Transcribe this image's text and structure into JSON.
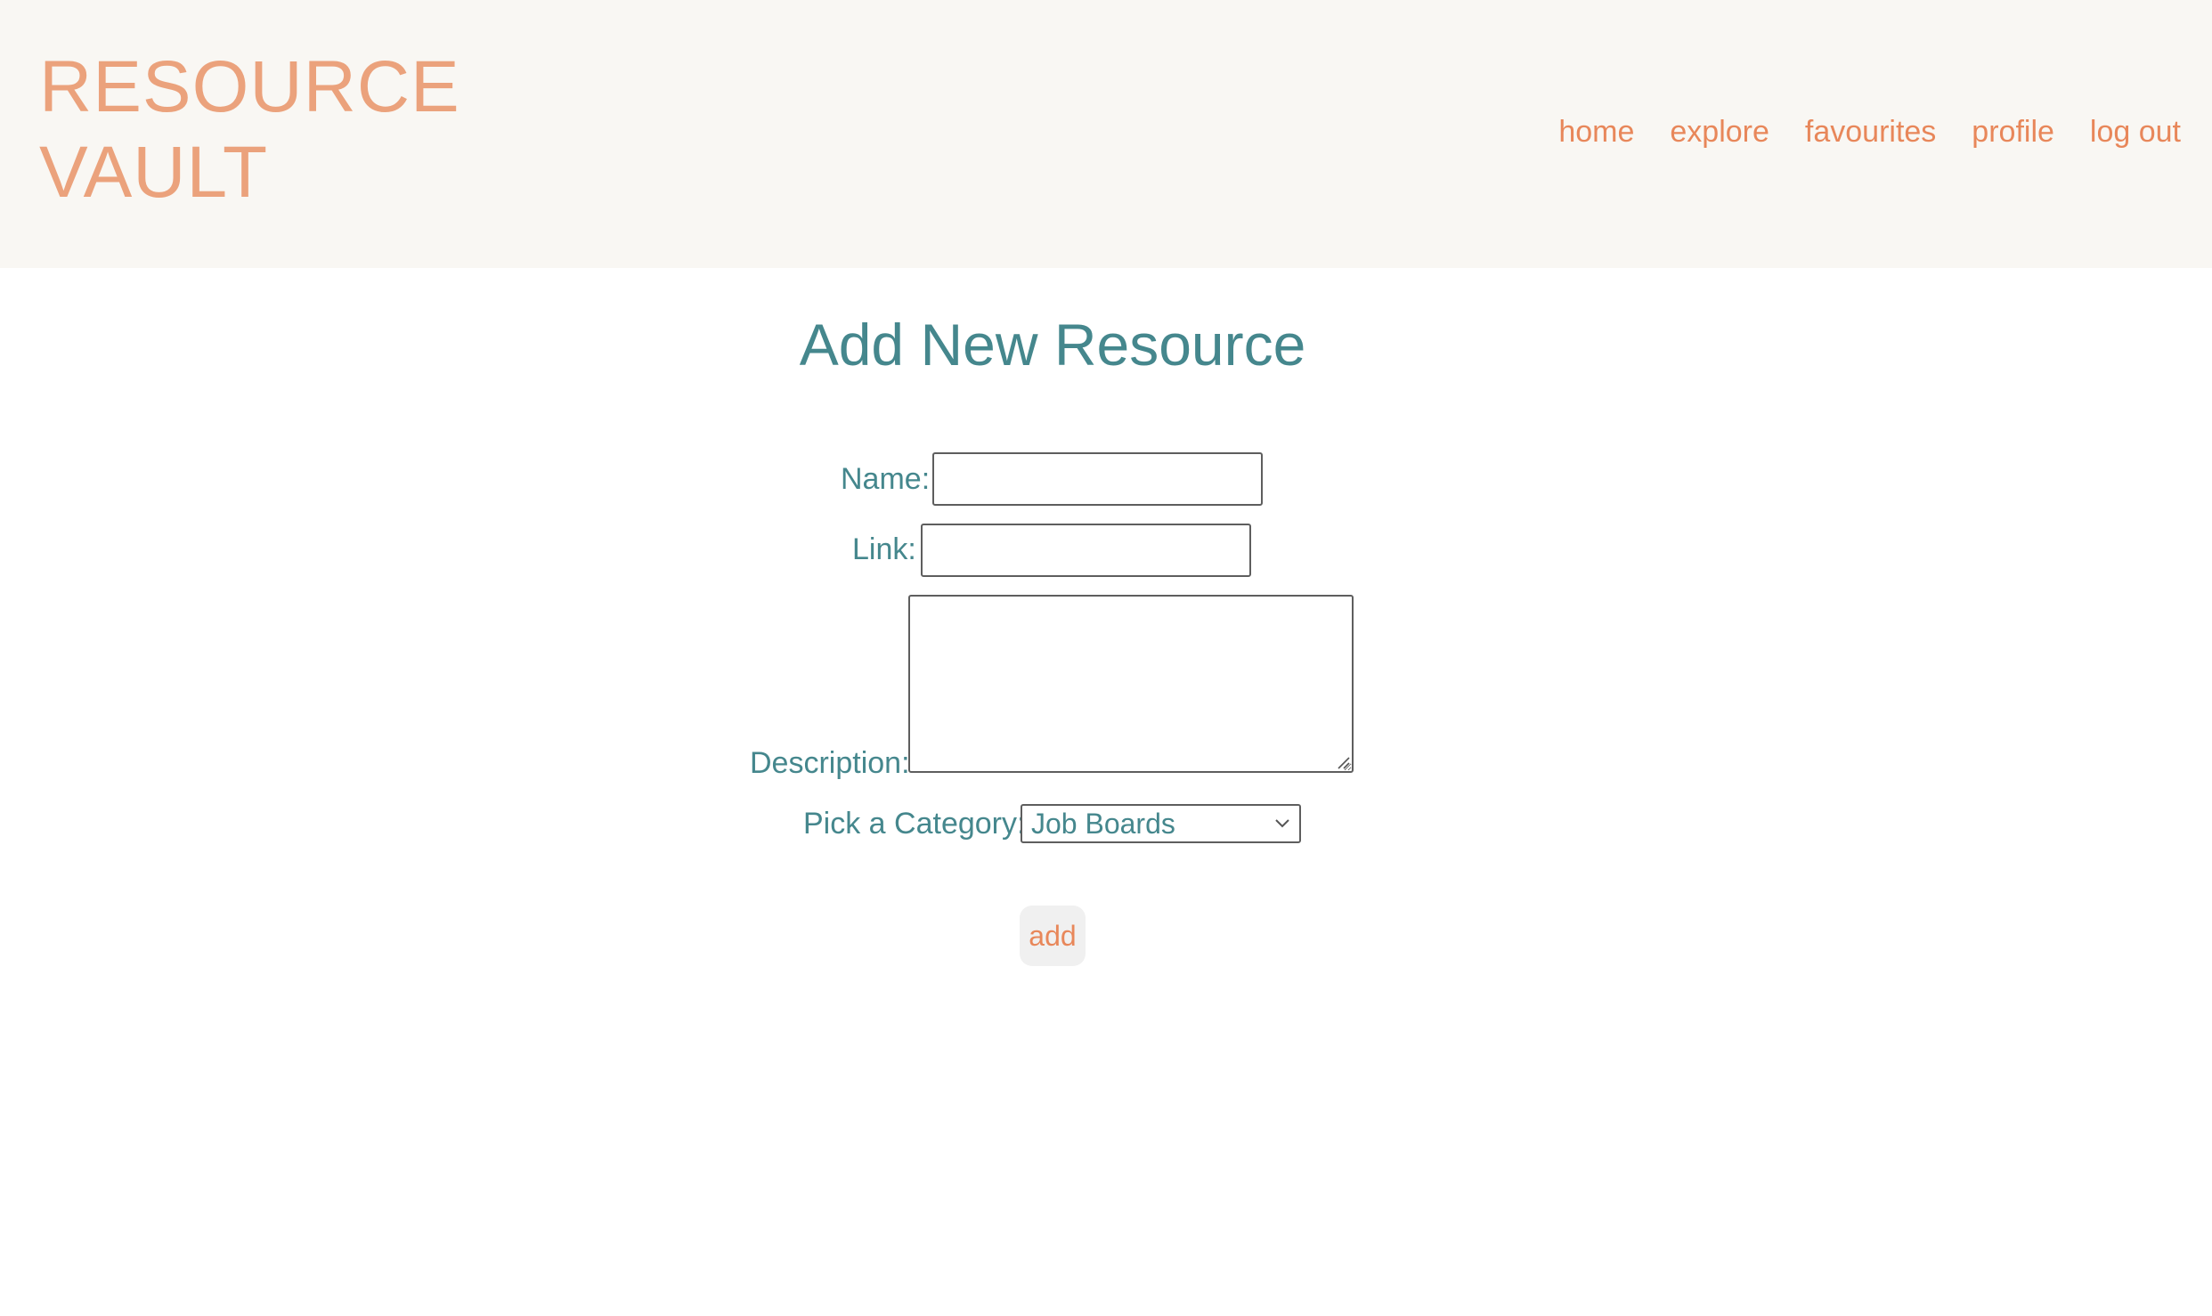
{
  "brand": {
    "line1": "RESOURCE",
    "line2": "VAULT"
  },
  "nav": {
    "items": [
      "home",
      "explore",
      "favourites",
      "profile",
      "log out"
    ]
  },
  "form": {
    "title": "Add New Resource",
    "name_label": "Name:",
    "name_value": "",
    "link_label": "Link:",
    "link_value": "",
    "description_label": "Description:",
    "description_value": "",
    "category_label": "Pick a Category:",
    "category_selected": "Job Boards",
    "submit_label": "add"
  },
  "colors": {
    "header_bg": "#f9f7f3",
    "brand": "#eba27c",
    "nav_link": "#e8875a",
    "teal_text": "#45878d",
    "button_bg": "#f0f0f0"
  },
  "icons": {
    "select_arrow": "chevron-down-icon",
    "textarea_resize": "resize-handle-icon"
  }
}
